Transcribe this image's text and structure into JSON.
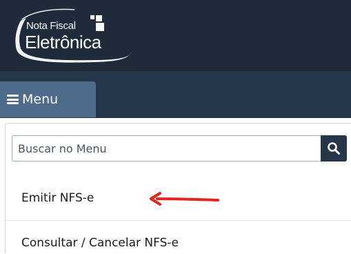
{
  "logo": {
    "line1": "Nota Fiscal",
    "line2": "Eletrônica"
  },
  "colors": {
    "header_bg": "#1d2b3a",
    "menubar_bg": "#243648",
    "menu_button_bg": "#4d6b8a",
    "search_button_bg": "#243648",
    "arrow": "#e0261f"
  },
  "menu": {
    "button_label": "Menu",
    "button_icon": "hamburger-icon",
    "search": {
      "placeholder": "Buscar no Menu",
      "value": "",
      "icon": "search-icon"
    },
    "items": [
      {
        "label": "Emitir NFS-e"
      },
      {
        "label": "Consultar / Cancelar NFS-e"
      }
    ]
  },
  "annotation": {
    "icon": "red-arrow-icon"
  }
}
